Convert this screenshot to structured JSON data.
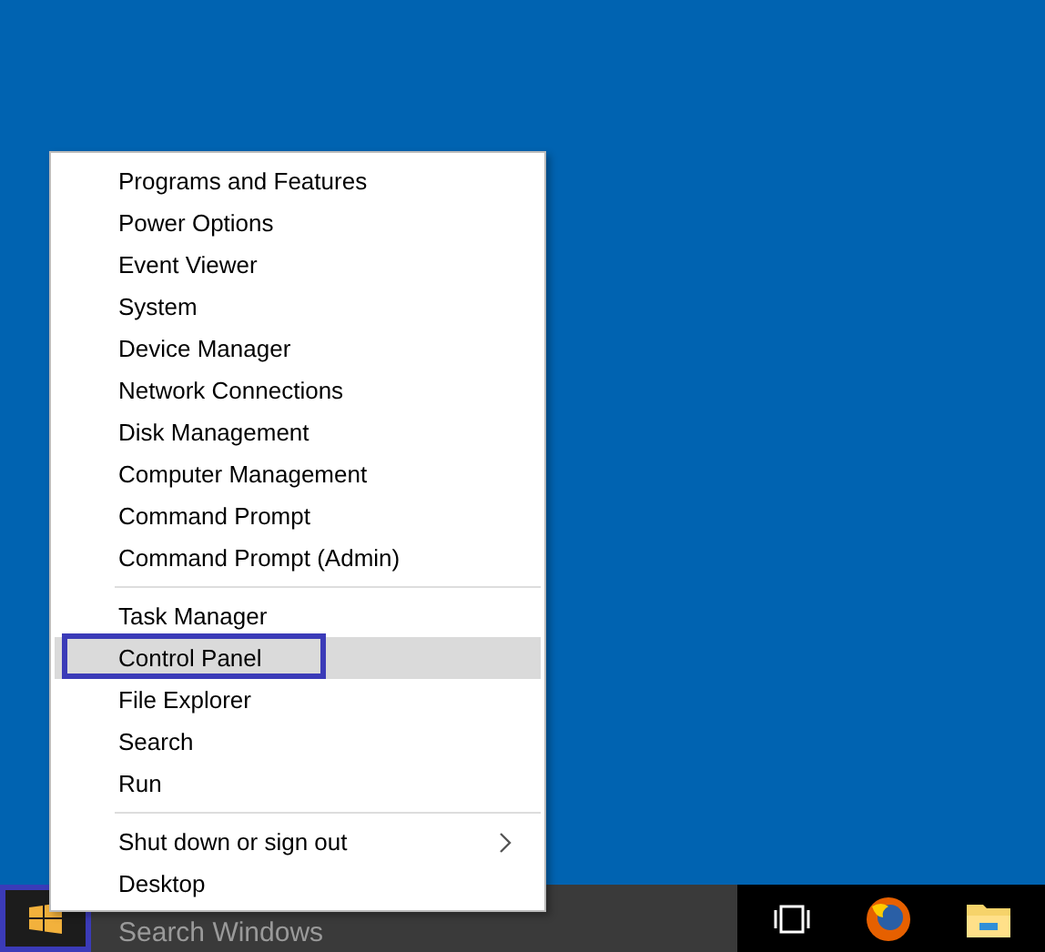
{
  "menu": {
    "groups": [
      {
        "items": [
          {
            "label": "Programs and Features",
            "selected": false,
            "highlighted": false,
            "submenu": false
          },
          {
            "label": "Power Options",
            "selected": false,
            "highlighted": false,
            "submenu": false
          },
          {
            "label": "Event Viewer",
            "selected": false,
            "highlighted": false,
            "submenu": false
          },
          {
            "label": "System",
            "selected": false,
            "highlighted": false,
            "submenu": false
          },
          {
            "label": "Device Manager",
            "selected": false,
            "highlighted": false,
            "submenu": false
          },
          {
            "label": "Network Connections",
            "selected": false,
            "highlighted": false,
            "submenu": false
          },
          {
            "label": "Disk Management",
            "selected": false,
            "highlighted": false,
            "submenu": false
          },
          {
            "label": "Computer Management",
            "selected": false,
            "highlighted": false,
            "submenu": false
          },
          {
            "label": "Command Prompt",
            "selected": false,
            "highlighted": false,
            "submenu": false
          },
          {
            "label": "Command Prompt (Admin)",
            "selected": false,
            "highlighted": false,
            "submenu": false
          }
        ]
      },
      {
        "items": [
          {
            "label": "Task Manager",
            "selected": false,
            "highlighted": false,
            "submenu": false
          },
          {
            "label": "Control Panel",
            "selected": true,
            "highlighted": true,
            "submenu": false
          },
          {
            "label": "File Explorer",
            "selected": false,
            "highlighted": false,
            "submenu": false
          },
          {
            "label": "Search",
            "selected": false,
            "highlighted": false,
            "submenu": false
          },
          {
            "label": "Run",
            "selected": false,
            "highlighted": false,
            "submenu": false
          }
        ]
      },
      {
        "items": [
          {
            "label": "Shut down or sign out",
            "selected": false,
            "highlighted": false,
            "submenu": true
          },
          {
            "label": "Desktop",
            "selected": false,
            "highlighted": false,
            "submenu": false
          }
        ]
      }
    ]
  },
  "taskbar": {
    "start_button": {
      "highlighted": true
    },
    "search": {
      "placeholder": "Search Windows"
    }
  }
}
